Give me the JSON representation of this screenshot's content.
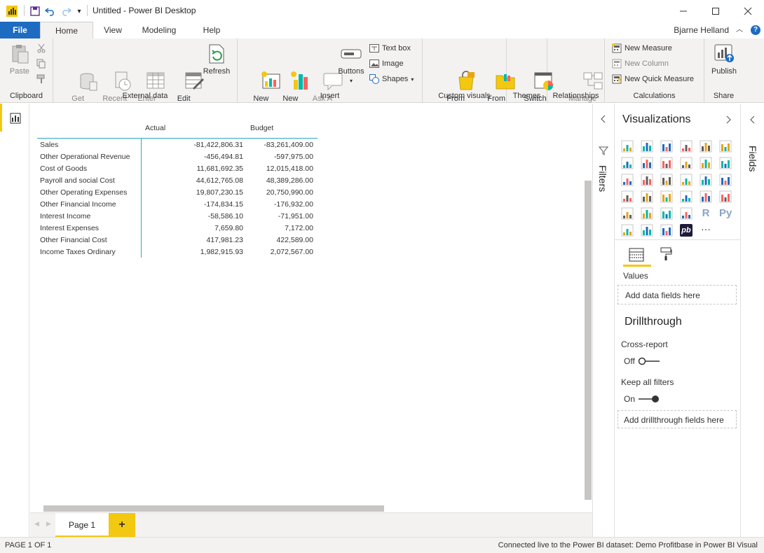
{
  "window": {
    "title": "Untitled - Power BI Desktop",
    "user": "Bjarne Helland"
  },
  "tabs": [
    {
      "label": "File"
    },
    {
      "label": "Home"
    },
    {
      "label": "View"
    },
    {
      "label": "Modeling"
    },
    {
      "label": "Help"
    }
  ],
  "ribbon": {
    "clipboard": {
      "label": "Clipboard",
      "paste": "Paste"
    },
    "external": {
      "label": "External data",
      "get_data": "Get\nData",
      "recent_sources": "Recent\nSources",
      "enter_data": "Enter\nData",
      "edit_queries": "Edit\nQueries",
      "refresh": "Refresh"
    },
    "insert": {
      "label": "Insert",
      "new_page": "New\nPage",
      "new_visual": "New\nVisual",
      "ask_question": "Ask A\nQuestion",
      "buttons": "Buttons",
      "text_box": "Text box",
      "image": "Image",
      "shapes": "Shapes"
    },
    "custom": {
      "label": "Custom visuals",
      "from_marketplace": "From\nMarketplace",
      "from_file": "From\nFile"
    },
    "themes": {
      "label": "Themes",
      "switch_theme": "Switch\nTheme"
    },
    "relationships": {
      "label": "Relationships",
      "manage": "Manage\nRelationships"
    },
    "calculations": {
      "label": "Calculations",
      "new_measure": "New Measure",
      "new_column": "New Column",
      "new_quick_measure": "New Quick Measure"
    },
    "share": {
      "label": "Share",
      "publish": "Publish"
    }
  },
  "matrix": {
    "columns": [
      "Actual",
      "Budget"
    ],
    "rows": [
      {
        "label": "Sales",
        "actual": "-81,422,806.31",
        "budget": "-83,261,409.00"
      },
      {
        "label": "Other Operational Revenue",
        "actual": "-456,494.81",
        "budget": "-597,975.00"
      },
      {
        "label": "Cost of Goods",
        "actual": "11,681,692.35",
        "budget": "12,015,418.00"
      },
      {
        "label": "Payroll and social Cost",
        "actual": "44,612,765.08",
        "budget": "48,389,286.00"
      },
      {
        "label": "Other Operating Expenses",
        "actual": "19,807,230.15",
        "budget": "20,750,990.00"
      },
      {
        "label": "Other Financial Income",
        "actual": "-174,834.15",
        "budget": "-176,932.00"
      },
      {
        "label": "Interest Income",
        "actual": "-58,586.10",
        "budget": "-71,951.00"
      },
      {
        "label": "Interest Expenses",
        "actual": "7,659.80",
        "budget": "7,172.00"
      },
      {
        "label": "Other Financial Cost",
        "actual": "417,981.23",
        "budget": "422,589.00"
      },
      {
        "label": "Income Taxes Ordinary",
        "actual": "1,982,915.93",
        "budget": "2,072,567.00"
      }
    ]
  },
  "pages": {
    "page1": "Page 1",
    "add": "+"
  },
  "filters": {
    "label": "Filters"
  },
  "visualizations": {
    "title": "Visualizations",
    "values_label": "Values",
    "values_placeholder": "Add data fields here",
    "drillthrough_title": "Drillthrough",
    "cross_report": "Cross-report",
    "cross_report_state": "Off",
    "keep_all_filters": "Keep all filters",
    "keep_all_filters_state": "On",
    "drill_placeholder": "Add drillthrough fields here",
    "r_label": "R",
    "py_label": "Py",
    "pb_label": "pb",
    "more": "···"
  },
  "fields_pane": {
    "label": "Fields"
  },
  "status": {
    "page": "PAGE 1 OF 1",
    "connection": "Connected live to the Power BI dataset: Demo Profitbase in Power BI Visual"
  },
  "colors": {
    "accent": "#1e6cc2",
    "powerbi_yellow": "#f2c811",
    "tab_underline": "#f2c811"
  }
}
